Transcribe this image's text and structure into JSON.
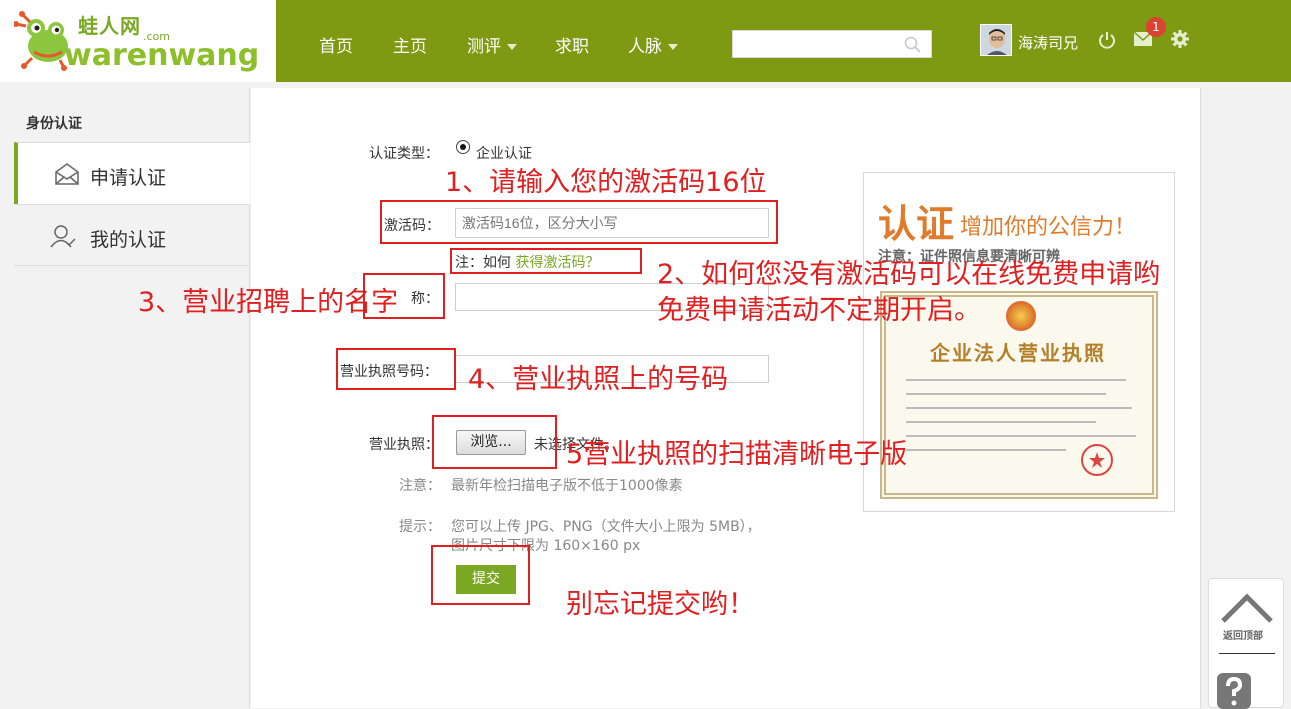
{
  "logo": {
    "cn": "蛙人网",
    "com": ".com",
    "en": "warenwang"
  },
  "nav": [
    {
      "label": "首页",
      "has_caret": false
    },
    {
      "label": "主页",
      "has_caret": false
    },
    {
      "label": "测评",
      "has_caret": true
    },
    {
      "label": "求职",
      "has_caret": false
    },
    {
      "label": "人脉",
      "has_caret": true
    }
  ],
  "search": {
    "value": "",
    "placeholder": ""
  },
  "user": {
    "name": "海涛司兄",
    "mail_count": "1"
  },
  "colors": {
    "topbar": "#7e9a12",
    "accent": "#7aa823",
    "annotation": "#e02020"
  },
  "sidebar": {
    "title": "身份认证",
    "items": [
      {
        "label": "申请认证",
        "icon": "envelope-icon",
        "active": true
      },
      {
        "label": "我的认证",
        "icon": "user-icon",
        "active": false
      }
    ]
  },
  "form": {
    "type_label": "认证类型：",
    "type_option": "企业认证",
    "code_label": "激活码：",
    "code_placeholder": "激活码16位，区分大小写",
    "code_note_prefix": "注：如何",
    "code_note_link": "获得激活码？",
    "company_label_tail": "称：",
    "license_no_label": "营业执照号码：",
    "license_file_label": "营业执照：",
    "browse_label": "浏览...",
    "no_file_text": "未选择文件。",
    "note_label": "注意：",
    "note_text": "最新年检扫描电子版不低于1000像素",
    "tip_label": "提示：",
    "tip_line1": "您可以上传 JPG、PNG（文件大小上限为 5MB），",
    "tip_line2": "图片尺寸下限为 160×160 px",
    "submit_label": "提交"
  },
  "annotations": {
    "a1": "1、请输入您的激活码16位",
    "a2_line1": "2、如何您没有激活码可以在线免费申请哟",
    "a2_line2": "免费申请活动不定期开启。",
    "a3": "3、营业招聘上的名字",
    "a4": "4、营业执照上的号码",
    "a5": "5营业执照的扫描清晰电子版",
    "a6": "别忘记提交哟！"
  },
  "cert_panel": {
    "title_big": "认证",
    "title_small": "增加你的公信力！",
    "subtitle": "注意：证件照信息要清晰可辨",
    "license_title": "企业法人营业执照"
  },
  "back_to_top": {
    "label": "返回顶部"
  }
}
